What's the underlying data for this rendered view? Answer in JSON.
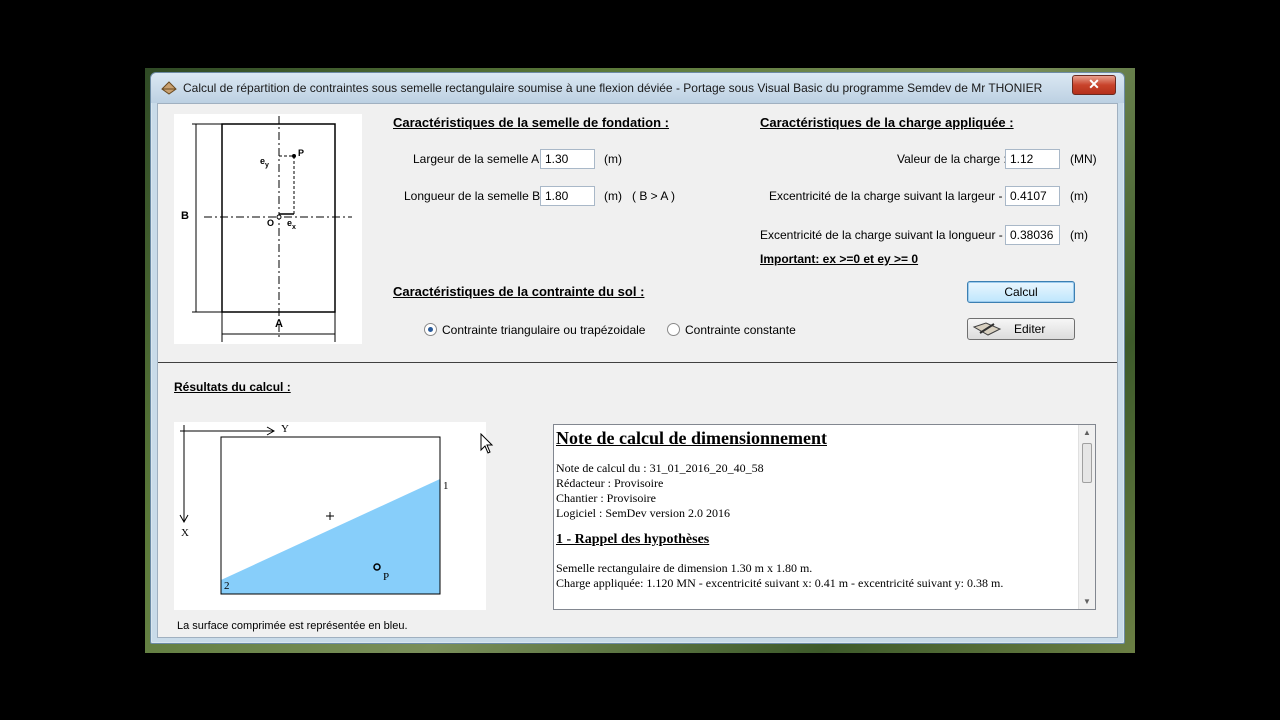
{
  "window": {
    "title": "Calcul de répartition de contraintes sous semelle rectangulaire soumise à une flexion déviée  - Portage sous Visual Basic du programme Semdev de Mr THONIER",
    "close_label": "✕"
  },
  "semelle": {
    "title": "Caractéristiques de la semelle de fondation :",
    "largeur_label": "Largeur de la semelle A :",
    "largeur_value": "1.30",
    "largeur_unit": "(m)",
    "longueur_label": "Longueur de la semelle B :",
    "longueur_value": "1.80",
    "longueur_unit": "(m)",
    "longueur_hint": "( B > A )"
  },
  "charge": {
    "title": "Caractéristiques de la charge appliquée :",
    "valeur_label": "Valeur de la charge :",
    "valeur_value": "1.12",
    "valeur_unit": "(MN)",
    "ex_label": "Excentricité de la charge suivant la largeur - ex :",
    "ex_value": "0.4107",
    "ex_unit": "(m)",
    "ey_label": "Excentricité de la charge suivant la longueur - ey :",
    "ey_value": "0.38036",
    "ey_unit": "(m)",
    "important": "Important: ex >=0 et ey >= 0"
  },
  "sol": {
    "title": "Caractéristiques de la contrainte du sol :",
    "option1": "Contrainte triangulaire ou trapézoidale",
    "option2": "Contrainte constante",
    "selected": "option1"
  },
  "buttons": {
    "calcul": "Calcul",
    "editer": "Editer"
  },
  "sketch": {
    "label_B": "B",
    "label_A": "A",
    "label_P": "P",
    "label_O": "O",
    "label_ey": "e",
    "label_ey_sub": "y",
    "label_ex": "e",
    "label_ex_sub": "x"
  },
  "resultats": {
    "title": "Résultats du calcul :",
    "caption": "La surface comprimée est représentée en bleu.",
    "diagram": {
      "axis_y": "Y",
      "axis_x": "X",
      "corner_1": "1",
      "corner_2": "2",
      "point_p": "P",
      "fill_color": "#87cefa"
    }
  },
  "note": {
    "heading": "Note de calcul de dimensionnement ",
    "lines": [
      "Note de calcul du : 31_01_2016_20_40_58",
      "Rédacteur : Provisoire",
      "Chantier : Provisoire",
      "Logiciel : SemDev version 2.0  2016"
    ],
    "section1": "1 - Rappel des hypothèses",
    "hyp_lines": [
      "Semelle rectangulaire de dimension 1.30 m x 1.80 m.",
      "Charge appliquée: 1.120 MN - excentricité suivant x: 0.41 m - excentricité suivant y: 0.38 m."
    ]
  }
}
